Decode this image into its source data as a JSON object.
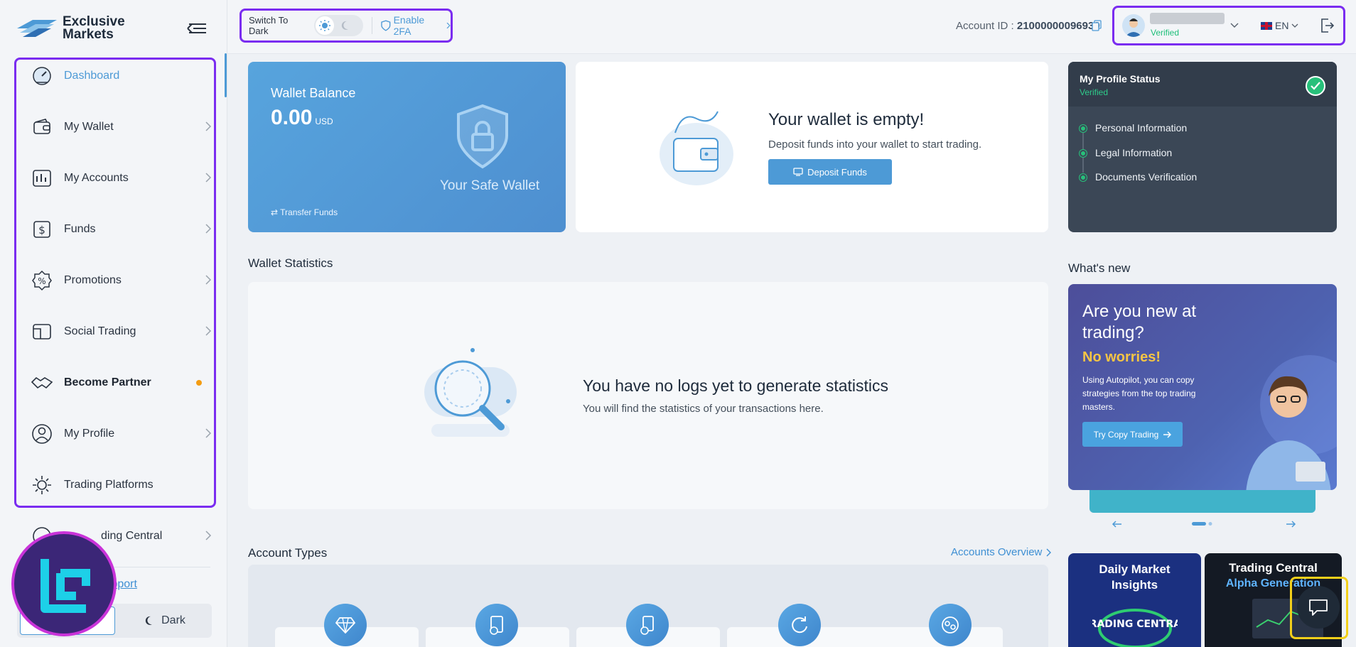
{
  "brand": {
    "name_line1": "Exclusive",
    "name_line2": "Markets"
  },
  "sidebar": {
    "items": [
      {
        "label": "Dashboard",
        "icon": "dashboard-gauge-icon",
        "active": true
      },
      {
        "label": "My Wallet",
        "icon": "wallet-icon"
      },
      {
        "label": "My Accounts",
        "icon": "accounts-chart-icon"
      },
      {
        "label": "Funds",
        "icon": "funds-dollar-icon"
      },
      {
        "label": "Promotions",
        "icon": "promotion-badge-icon"
      },
      {
        "label": "Social Trading",
        "icon": "social-trading-icon"
      },
      {
        "label": "Become Partner",
        "icon": "handshake-icon"
      },
      {
        "label": "My Profile",
        "icon": "user-profile-icon"
      },
      {
        "label": "Trading Platforms",
        "icon": "platforms-gear-icon"
      },
      {
        "label": "ding Central",
        "icon": "trading-central-icon"
      }
    ],
    "contact_support": "ct Support",
    "theme_light": "",
    "theme_dark": "Dark"
  },
  "topbar": {
    "switch_label": "Switch To Dark",
    "enable_2fa": "Enable 2FA",
    "account_id_label": "Account ID :",
    "account_id_value": "21000000096939",
    "verified": "Verified",
    "language": "EN"
  },
  "wallet": {
    "title": "Wallet Balance",
    "amount": "0.00",
    "currency": "USD",
    "safe_text": "Your Safe Wallet",
    "transfer": "Transfer Funds"
  },
  "empty_wallet": {
    "title": "Your wallet is empty!",
    "subtitle": "Deposit funds into your wallet to start trading.",
    "button": "Deposit Funds"
  },
  "stats": {
    "section_title": "Wallet Statistics",
    "title": "You have no logs yet to generate statistics",
    "subtitle": "You will find the statistics of your transactions here."
  },
  "account_types": {
    "section_title": "Account Types",
    "overview_link": "Accounts Overview"
  },
  "profile_status": {
    "title": "My Profile Status",
    "status": "Verified",
    "steps": [
      "Personal Information",
      "Legal Information",
      "Documents Verification"
    ]
  },
  "whats_new": {
    "title": "What's new",
    "headline": "Are you new at trading?",
    "highlight": "No worries!",
    "body": "Using Autopilot, you can copy strategies from the top trading masters.",
    "button": "Try Copy Trading"
  },
  "insights": [
    {
      "line1": "Daily Market",
      "line2": "Insights",
      "logo": "TRADING CENTRAL"
    },
    {
      "line1": "Trading Central",
      "line2": "Alpha Generation"
    }
  ],
  "colors": {
    "accent": "#4d9ad6",
    "highlight": "#7a2cf0",
    "success": "#27c07a",
    "partner_dot": "#f39c12"
  }
}
